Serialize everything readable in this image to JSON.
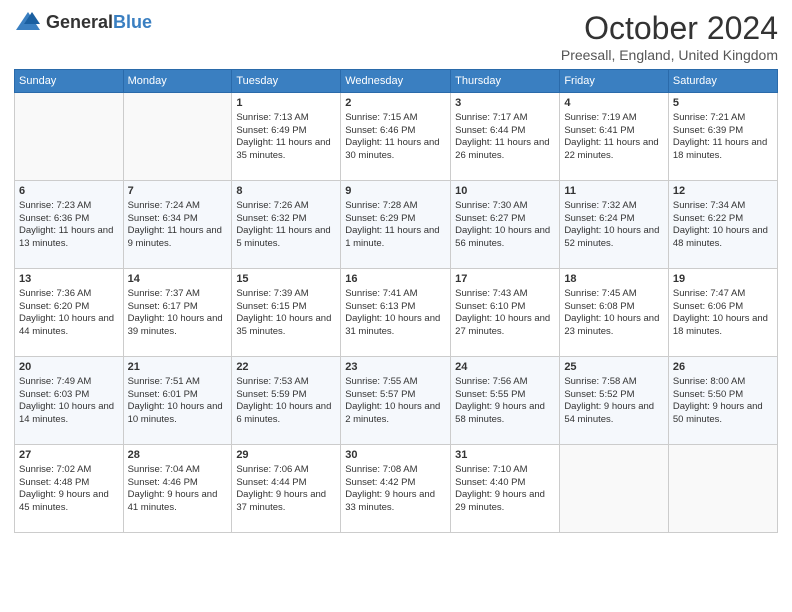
{
  "header": {
    "logo": {
      "general": "General",
      "blue": "Blue"
    },
    "title": "October 2024",
    "location": "Preesall, England, United Kingdom"
  },
  "days_of_week": [
    "Sunday",
    "Monday",
    "Tuesday",
    "Wednesday",
    "Thursday",
    "Friday",
    "Saturday"
  ],
  "weeks": [
    [
      {
        "day": "",
        "sunrise": "",
        "sunset": "",
        "daylight": ""
      },
      {
        "day": "",
        "sunrise": "",
        "sunset": "",
        "daylight": ""
      },
      {
        "day": "1",
        "sunrise": "Sunrise: 7:13 AM",
        "sunset": "Sunset: 6:49 PM",
        "daylight": "Daylight: 11 hours and 35 minutes."
      },
      {
        "day": "2",
        "sunrise": "Sunrise: 7:15 AM",
        "sunset": "Sunset: 6:46 PM",
        "daylight": "Daylight: 11 hours and 30 minutes."
      },
      {
        "day": "3",
        "sunrise": "Sunrise: 7:17 AM",
        "sunset": "Sunset: 6:44 PM",
        "daylight": "Daylight: 11 hours and 26 minutes."
      },
      {
        "day": "4",
        "sunrise": "Sunrise: 7:19 AM",
        "sunset": "Sunset: 6:41 PM",
        "daylight": "Daylight: 11 hours and 22 minutes."
      },
      {
        "day": "5",
        "sunrise": "Sunrise: 7:21 AM",
        "sunset": "Sunset: 6:39 PM",
        "daylight": "Daylight: 11 hours and 18 minutes."
      }
    ],
    [
      {
        "day": "6",
        "sunrise": "Sunrise: 7:23 AM",
        "sunset": "Sunset: 6:36 PM",
        "daylight": "Daylight: 11 hours and 13 minutes."
      },
      {
        "day": "7",
        "sunrise": "Sunrise: 7:24 AM",
        "sunset": "Sunset: 6:34 PM",
        "daylight": "Daylight: 11 hours and 9 minutes."
      },
      {
        "day": "8",
        "sunrise": "Sunrise: 7:26 AM",
        "sunset": "Sunset: 6:32 PM",
        "daylight": "Daylight: 11 hours and 5 minutes."
      },
      {
        "day": "9",
        "sunrise": "Sunrise: 7:28 AM",
        "sunset": "Sunset: 6:29 PM",
        "daylight": "Daylight: 11 hours and 1 minute."
      },
      {
        "day": "10",
        "sunrise": "Sunrise: 7:30 AM",
        "sunset": "Sunset: 6:27 PM",
        "daylight": "Daylight: 10 hours and 56 minutes."
      },
      {
        "day": "11",
        "sunrise": "Sunrise: 7:32 AM",
        "sunset": "Sunset: 6:24 PM",
        "daylight": "Daylight: 10 hours and 52 minutes."
      },
      {
        "day": "12",
        "sunrise": "Sunrise: 7:34 AM",
        "sunset": "Sunset: 6:22 PM",
        "daylight": "Daylight: 10 hours and 48 minutes."
      }
    ],
    [
      {
        "day": "13",
        "sunrise": "Sunrise: 7:36 AM",
        "sunset": "Sunset: 6:20 PM",
        "daylight": "Daylight: 10 hours and 44 minutes."
      },
      {
        "day": "14",
        "sunrise": "Sunrise: 7:37 AM",
        "sunset": "Sunset: 6:17 PM",
        "daylight": "Daylight: 10 hours and 39 minutes."
      },
      {
        "day": "15",
        "sunrise": "Sunrise: 7:39 AM",
        "sunset": "Sunset: 6:15 PM",
        "daylight": "Daylight: 10 hours and 35 minutes."
      },
      {
        "day": "16",
        "sunrise": "Sunrise: 7:41 AM",
        "sunset": "Sunset: 6:13 PM",
        "daylight": "Daylight: 10 hours and 31 minutes."
      },
      {
        "day": "17",
        "sunrise": "Sunrise: 7:43 AM",
        "sunset": "Sunset: 6:10 PM",
        "daylight": "Daylight: 10 hours and 27 minutes."
      },
      {
        "day": "18",
        "sunrise": "Sunrise: 7:45 AM",
        "sunset": "Sunset: 6:08 PM",
        "daylight": "Daylight: 10 hours and 23 minutes."
      },
      {
        "day": "19",
        "sunrise": "Sunrise: 7:47 AM",
        "sunset": "Sunset: 6:06 PM",
        "daylight": "Daylight: 10 hours and 18 minutes."
      }
    ],
    [
      {
        "day": "20",
        "sunrise": "Sunrise: 7:49 AM",
        "sunset": "Sunset: 6:03 PM",
        "daylight": "Daylight: 10 hours and 14 minutes."
      },
      {
        "day": "21",
        "sunrise": "Sunrise: 7:51 AM",
        "sunset": "Sunset: 6:01 PM",
        "daylight": "Daylight: 10 hours and 10 minutes."
      },
      {
        "day": "22",
        "sunrise": "Sunrise: 7:53 AM",
        "sunset": "Sunset: 5:59 PM",
        "daylight": "Daylight: 10 hours and 6 minutes."
      },
      {
        "day": "23",
        "sunrise": "Sunrise: 7:55 AM",
        "sunset": "Sunset: 5:57 PM",
        "daylight": "Daylight: 10 hours and 2 minutes."
      },
      {
        "day": "24",
        "sunrise": "Sunrise: 7:56 AM",
        "sunset": "Sunset: 5:55 PM",
        "daylight": "Daylight: 9 hours and 58 minutes."
      },
      {
        "day": "25",
        "sunrise": "Sunrise: 7:58 AM",
        "sunset": "Sunset: 5:52 PM",
        "daylight": "Daylight: 9 hours and 54 minutes."
      },
      {
        "day": "26",
        "sunrise": "Sunrise: 8:00 AM",
        "sunset": "Sunset: 5:50 PM",
        "daylight": "Daylight: 9 hours and 50 minutes."
      }
    ],
    [
      {
        "day": "27",
        "sunrise": "Sunrise: 7:02 AM",
        "sunset": "Sunset: 4:48 PM",
        "daylight": "Daylight: 9 hours and 45 minutes."
      },
      {
        "day": "28",
        "sunrise": "Sunrise: 7:04 AM",
        "sunset": "Sunset: 4:46 PM",
        "daylight": "Daylight: 9 hours and 41 minutes."
      },
      {
        "day": "29",
        "sunrise": "Sunrise: 7:06 AM",
        "sunset": "Sunset: 4:44 PM",
        "daylight": "Daylight: 9 hours and 37 minutes."
      },
      {
        "day": "30",
        "sunrise": "Sunrise: 7:08 AM",
        "sunset": "Sunset: 4:42 PM",
        "daylight": "Daylight: 9 hours and 33 minutes."
      },
      {
        "day": "31",
        "sunrise": "Sunrise: 7:10 AM",
        "sunset": "Sunset: 4:40 PM",
        "daylight": "Daylight: 9 hours and 29 minutes."
      },
      {
        "day": "",
        "sunrise": "",
        "sunset": "",
        "daylight": ""
      },
      {
        "day": "",
        "sunrise": "",
        "sunset": "",
        "daylight": ""
      }
    ]
  ]
}
